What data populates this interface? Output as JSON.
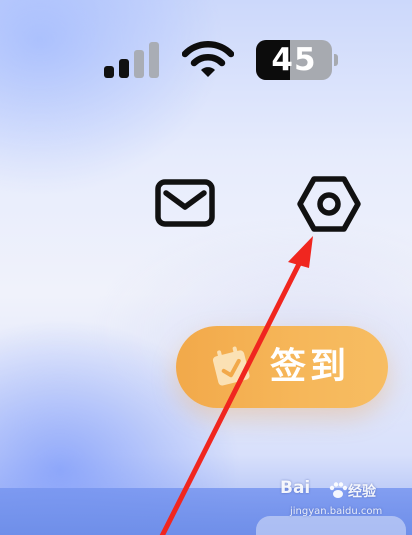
{
  "status_bar": {
    "battery_level": "45",
    "signal": {
      "bars_total": 4,
      "bars_active": 2
    },
    "signal_icon": "cellular-signal-icon",
    "wifi_icon": "wifi-icon",
    "battery_icon": "battery-icon"
  },
  "header": {
    "mail_icon": "envelope-icon",
    "settings_icon": "hexagon-nut-settings-icon"
  },
  "checkin": {
    "label": "签到",
    "icon": "calendar-check-icon",
    "color": "#f4b154"
  },
  "watermark": {
    "brand": "Bai",
    "suffix": "经验",
    "domain": "jingyan.baidu.com"
  },
  "colors": {
    "annotation_arrow": "#f0261f",
    "accent_orange": "#f4b154",
    "bottom_band": "#7594ea"
  }
}
